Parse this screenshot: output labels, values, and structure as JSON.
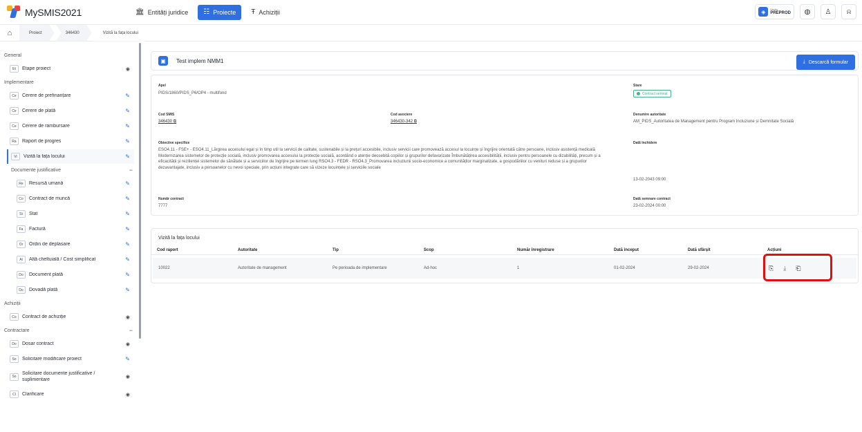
{
  "app": {
    "title": "MySMIS2021"
  },
  "nav": {
    "items": [
      {
        "label": "Entități juridice",
        "icon": "building-icon"
      },
      {
        "label": "Proiecte",
        "icon": "projects-icon"
      },
      {
        "label": "Achiziții",
        "icon": "acquisitions-icon"
      }
    ]
  },
  "env": {
    "small": "Mediu",
    "big": "PREPROD"
  },
  "breadcrumb": [
    "Proiect",
    "346430",
    "Vizită la fața locului"
  ],
  "sidebar": {
    "general": {
      "title": "General",
      "items": [
        {
          "pre": "Et",
          "label": "Etape proiect"
        }
      ]
    },
    "implementare": {
      "title": "Implementare",
      "items": [
        {
          "pre": "Ce",
          "label": "Cerere de prefinanțare"
        },
        {
          "pre": "Ce",
          "label": "Cerere de plată"
        },
        {
          "pre": "Ce",
          "label": "Cerere de rambursare"
        },
        {
          "pre": "Ra",
          "label": "Raport de progres"
        },
        {
          "pre": "Vi",
          "label": "Vizită la fața locului"
        }
      ]
    },
    "documente": {
      "title": "Documente justificative",
      "items": [
        {
          "pre": "Re",
          "label": "Resursă umană"
        },
        {
          "pre": "Co",
          "label": "Contract de muncă"
        },
        {
          "pre": "St",
          "label": "Stat"
        },
        {
          "pre": "Fa",
          "label": "Factură"
        },
        {
          "pre": "Or",
          "label": "Ordin de deplasare"
        },
        {
          "pre": "Al",
          "label": "Altă cheltuială / Cost simplificat"
        },
        {
          "pre": "Do",
          "label": "Document plată"
        },
        {
          "pre": "Do",
          "label": "Dovadă plată"
        }
      ]
    },
    "achizitii": {
      "title": "Achiziții",
      "items": [
        {
          "pre": "Co",
          "label": "Contract de achiziție"
        }
      ]
    },
    "contractare": {
      "title": "Contractare",
      "items": [
        {
          "pre": "Do",
          "label": "Dosar contract"
        },
        {
          "pre": "So",
          "label": "Solicitare modificare proiect"
        },
        {
          "pre": "So",
          "label": "Solicitare documente justificative / suplimentare"
        },
        {
          "pre": "Cl",
          "label": "Clarificare"
        }
      ]
    }
  },
  "project": {
    "title": "Test implem NMM1",
    "download_label": "Descarcă formular",
    "apel_label": "Apel",
    "apel_value": "PIDS/1860/PIDS_P6/OP4 - multifond",
    "stare_label": "Stare",
    "stare_value": "Contract semnat",
    "cod_smis_label": "Cod SMIS",
    "cod_smis_value": "346430",
    "cod_asociere_label": "Cod asociere",
    "cod_asociere_value": "346430-342",
    "autoritate_label": "Denumire autoritate",
    "autoritate_value": "AM_PIDS_Autoritatea de Management pentru Program Incluziune și Demnitate Socială",
    "obiective_label": "Obiective specifice",
    "obiective_value": "ESO4.11 - FSE+ - ESO4.11_Lărgirea accesului egal și în timp util la servicii de calitate, sustenabile și la prețuri accesibile, inclusiv servicii care promovează accesul la locuințe și îngrijire orientată către persoane, inclusiv asistență medicală Modernizarea sistemelor de protecție socială, inclusiv promovarea accesului la protecție socială, acordând o atenție deosebită copiilor și grupurilor defavorizate Îmbunătățirea accesibilității, inclusiv pentru persoanele cu dizabilități, precum și a eficacității și rezilienței sistemelor de sănătate și a serviciilor de îngrijire pe termen lung RSO4.3 - FEDR - RSO4.3_Promovarea incluziunii socio-economice a comunităților marginalizate, a gospodăriilor cu venituri reduse și a grupurilor dezavantajate, inclusiv a persoanelor cu nevoi speciale, prin acțiuni integrate care să vizeze locuințele și serviciile sociale",
    "inchidere_label": "Dată închidere",
    "inchidere_value": "13-02-2043 09:00",
    "nr_contract_label": "Număr contract",
    "nr_contract_value": "7777",
    "semnare_label": "Dată semnare contract",
    "semnare_value": "23-02-2024 00:00"
  },
  "visits": {
    "title": "Vizită la fața locului",
    "columns": [
      "Cod raport",
      "Autoritate",
      "Tip",
      "Scop",
      "Număr înregistrare",
      "Dată început",
      "Dată sfârșit",
      "Acțiuni"
    ],
    "rows": [
      [
        "10022",
        "Autoritate de management",
        "Pe perioada de implementare",
        "Ad-hoc",
        "1",
        "01-02-2024",
        "29-02-2024"
      ]
    ]
  },
  "colors": {
    "accent": "#2f6fe0",
    "success": "#3fb58a",
    "highlight": "#e01010"
  }
}
